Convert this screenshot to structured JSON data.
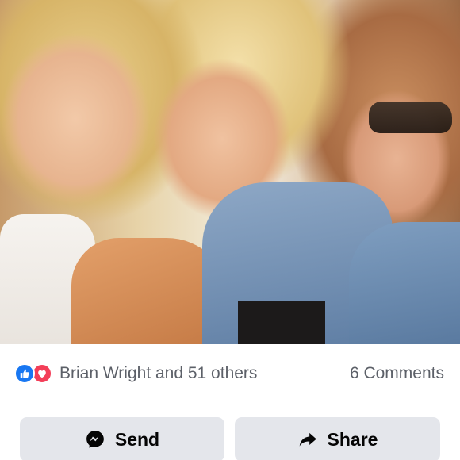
{
  "post": {
    "reactions": {
      "icons": [
        "like-icon",
        "love-icon"
      ],
      "summary": "Brian Wright and 51 others"
    },
    "comments_count": "6 Comments",
    "actions": {
      "send_label": "Send",
      "send_icon": "messenger-icon",
      "share_label": "Share",
      "share_icon": "share-arrow-icon"
    }
  },
  "colors": {
    "like": "#1877f2",
    "love": "#f33e58",
    "button_bg": "#e4e6eb",
    "meta_text": "#5c6068"
  }
}
